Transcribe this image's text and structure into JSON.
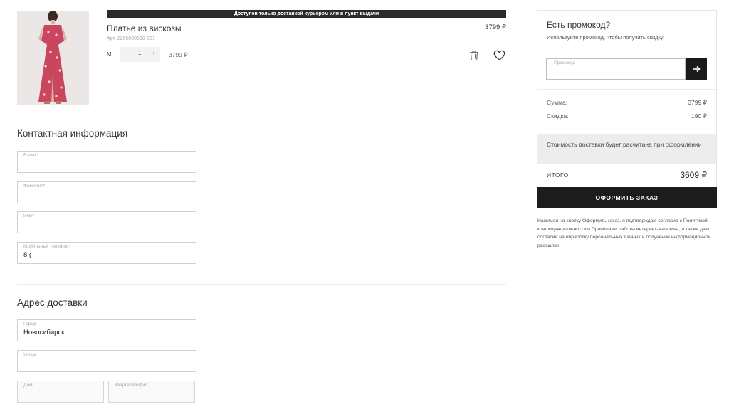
{
  "cart_item": {
    "banner": "Доступен только доставкой курьером или в пункт выдачи",
    "title": "Платье из вискозы",
    "price": "3799 ₽",
    "article": "Арт. 2266030530-207",
    "size": "М",
    "quantity": "1",
    "qty_minus": "–",
    "qty_plus": "+",
    "line_total": "3799 ₽"
  },
  "contact": {
    "title": "Контактная информация",
    "email_label": "E-mail*",
    "email_value": "",
    "surname_label": "Фамилия*",
    "surname_value": "",
    "name_label": "Имя*",
    "name_value": "",
    "phone_label": "Мобильный телефон*",
    "phone_value": "8 ("
  },
  "address": {
    "title": "Адрес доставки",
    "city_label": "Город",
    "city_value": "Новосибирск",
    "street_label": "Улица",
    "street_value": "",
    "house_label": "Дом",
    "house_value": "",
    "apt_label": "Квартира/офис",
    "apt_value": ""
  },
  "summary": {
    "promo_title": "Есть промокод?",
    "promo_subtitle": "Используйте промокод, чтобы получить скидку",
    "promo_placeholder": "Промокод",
    "sum_label": "Сумма:",
    "sum_value": "3799 ₽",
    "discount_label": "Скидка:",
    "discount_value": "190 ₽",
    "delivery_note": "Стоимость доставки будет расчитана при оформлении",
    "total_label": "ИТОГО",
    "total_value": "3609 ₽",
    "order_button": "ОФОРМИТЬ ЗАКАЗ",
    "consent": "Нажимая на кнопку Оформить заказ, я подтверждаю согласие с Политикой конфиденциальности и Правилами работы интернет-магазина, а также даю согласие на обработку персональных данных и получение информационной рассылки"
  },
  "icons": {
    "trash": "trash-icon",
    "heart": "heart-icon",
    "arrow": "arrow-right-icon"
  },
  "colors": {
    "dark": "#1c1c1c",
    "border": "#cfcfcf",
    "note_bg": "#ededed"
  }
}
